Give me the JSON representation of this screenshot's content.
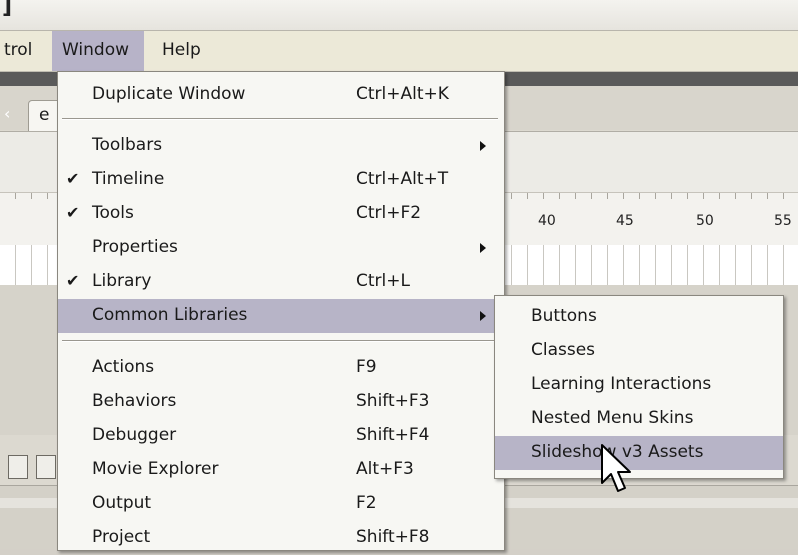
{
  "window": {
    "title_fragment": "]"
  },
  "menubar": {
    "items": [
      {
        "label": "trol"
      },
      {
        "label": "Window"
      },
      {
        "label": "Help"
      }
    ]
  },
  "document": {
    "tab_label": "e",
    "tab_scroll_arrow": "‹",
    "ruler_numbers": [
      "40",
      "45",
      "50",
      "55"
    ]
  },
  "window_menu": {
    "items": [
      {
        "label": "Duplicate Window",
        "shortcut": "Ctrl+Alt+K",
        "checked": false,
        "submenu": false
      },
      {
        "label": "Toolbars",
        "shortcut": "",
        "checked": false,
        "submenu": true
      },
      {
        "label": "Timeline",
        "shortcut": "Ctrl+Alt+T",
        "checked": true,
        "submenu": false
      },
      {
        "label": "Tools",
        "shortcut": "Ctrl+F2",
        "checked": true,
        "submenu": false
      },
      {
        "label": "Properties",
        "shortcut": "",
        "checked": false,
        "submenu": true
      },
      {
        "label": "Library",
        "shortcut": "Ctrl+L",
        "checked": true,
        "submenu": false
      },
      {
        "label": "Common Libraries",
        "shortcut": "",
        "checked": false,
        "submenu": true,
        "highlighted": true
      },
      {
        "label": "Actions",
        "shortcut": "F9",
        "checked": false,
        "submenu": false
      },
      {
        "label": "Behaviors",
        "shortcut": "Shift+F3",
        "checked": false,
        "submenu": false
      },
      {
        "label": "Debugger",
        "shortcut": "Shift+F4",
        "checked": false,
        "submenu": false
      },
      {
        "label": "Movie Explorer",
        "shortcut": "Alt+F3",
        "checked": false,
        "submenu": false
      },
      {
        "label": "Output",
        "shortcut": "F2",
        "checked": false,
        "submenu": false
      },
      {
        "label": "Project",
        "shortcut": "Shift+F8",
        "checked": false,
        "submenu": false
      }
    ],
    "check_glyph": "✔"
  },
  "common_libraries_submenu": {
    "items": [
      {
        "label": "Buttons"
      },
      {
        "label": "Classes"
      },
      {
        "label": "Learning Interactions"
      },
      {
        "label": "Nested Menu Skins"
      },
      {
        "label": "Slideshow v3 Assets",
        "highlighted": true
      }
    ]
  },
  "colors": {
    "menu_highlight": "#b7b4c7",
    "menu_background": "#f7f7f3",
    "menubar_background": "#ece9d8"
  }
}
